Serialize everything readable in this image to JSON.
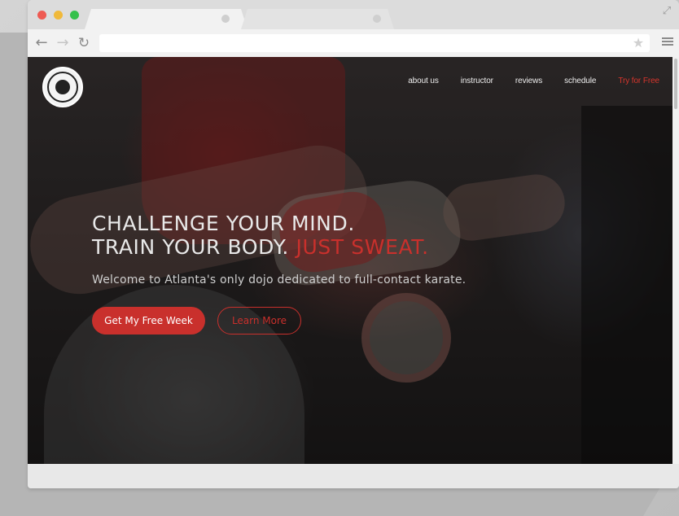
{
  "browser": {
    "address_value": "",
    "back_icon": "arrow-left-icon",
    "forward_icon": "arrow-right-icon",
    "reload_icon": "reload-icon",
    "bookmark_icon": "star-icon",
    "menu_icon": "hamburger-menu-icon",
    "expand_icon": "expand-icon",
    "traffic_lights": {
      "close": "#ee5a52",
      "minimize": "#f0b93a",
      "zoom": "#35c14b"
    }
  },
  "site": {
    "logo_name": "karate-organization-seal",
    "nav": [
      {
        "label": "about us"
      },
      {
        "label": "instructor"
      },
      {
        "label": "reviews"
      },
      {
        "label": "schedule"
      },
      {
        "label": "Try for Free"
      }
    ],
    "hero": {
      "headline_line1": "CHALLENGE YOUR MIND.",
      "headline_line2": "TRAIN YOUR BODY.",
      "headline_accent": "JUST SWEAT.",
      "subtitle": "Welcome to Atlanta's only dojo dedicated to full-contact karate.",
      "primary_button": "Get My Free Week",
      "secondary_button": "Learn More"
    }
  },
  "colors": {
    "accent": "#c9302c",
    "nav_text": "#ededed",
    "headline_text": "#e8e8e8"
  }
}
